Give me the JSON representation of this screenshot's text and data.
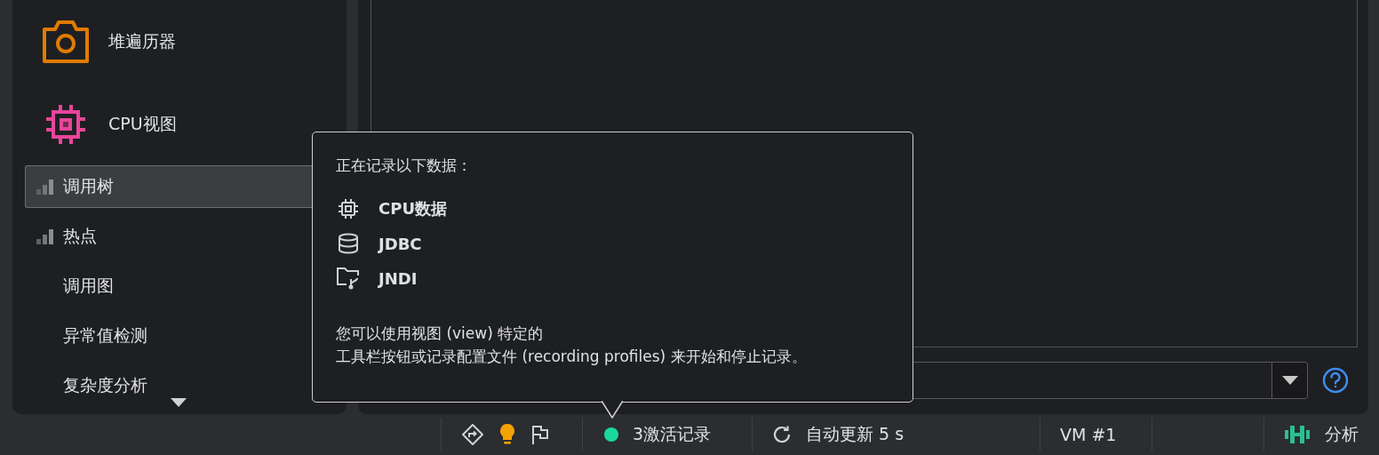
{
  "sidebar": {
    "sections": [
      {
        "kind": "heap",
        "label": "堆遍历器",
        "color": "#e07b00"
      },
      {
        "kind": "cpu",
        "label": "CPU视图",
        "color": "#e8459a",
        "children": [
          {
            "label": "调用树",
            "selected": true,
            "recorded": true
          },
          {
            "label": "热点",
            "selected": false,
            "recorded": true
          },
          {
            "label": "调用图",
            "selected": false,
            "recorded": false
          },
          {
            "label": "异常值检测",
            "selected": false,
            "recorded": false
          },
          {
            "label": "复杂度分析",
            "selected": false,
            "recorded": false
          }
        ]
      }
    ]
  },
  "tooltip": {
    "heading": "正在记录以下数据：",
    "items": [
      {
        "kind": "cpu",
        "label": "CPU数据"
      },
      {
        "kind": "database",
        "label": "JDBC"
      },
      {
        "kind": "jndi",
        "label": "JNDI"
      }
    ],
    "note_lines": [
      "您可以使用视图 (view) 特定的",
      "工具栏按钮或记录配置文件 (recording profiles) 来开始和停止记录。"
    ]
  },
  "status_bar": [
    {
      "kind": "tools"
    },
    {
      "kind": "recordings",
      "text": "3激活记录",
      "active": true
    },
    {
      "kind": "refresh",
      "text": "自动更新 5 s"
    },
    {
      "kind": "vm",
      "text": "VM #1"
    },
    {
      "kind": "blank"
    },
    {
      "kind": "analysis",
      "text": "分析"
    }
  ]
}
